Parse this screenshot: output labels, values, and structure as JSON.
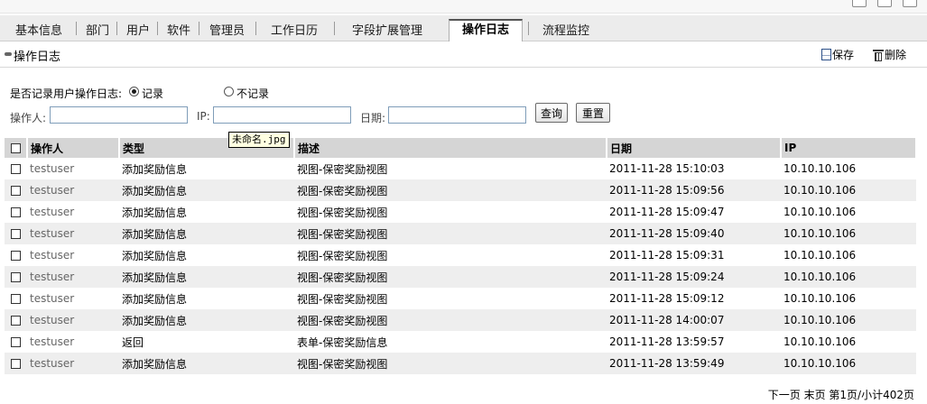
{
  "tabs": [
    {
      "label": "基本信息"
    },
    {
      "label": "部门"
    },
    {
      "label": "用户"
    },
    {
      "label": "软件"
    },
    {
      "label": "管理员"
    },
    {
      "label": "工作日历"
    },
    {
      "label": "字段扩展管理"
    },
    {
      "label": "操作日志"
    },
    {
      "label": "流程监控"
    }
  ],
  "page": {
    "title": "操作日志",
    "save_label": "保存",
    "delete_label": "删除"
  },
  "filters": {
    "record_question": "是否记录用户操作日志:",
    "record_on_label": "记录",
    "record_off_label": "不记录",
    "record_selected": "记录",
    "operator_label": "操作人:",
    "operator_value": "",
    "ip_label": "IP:",
    "ip_value": "",
    "date_label": "日期:",
    "date_value": "",
    "query_label": "查询",
    "reset_label": "重置"
  },
  "tooltip": "未命名.jpg",
  "table": {
    "headers": [
      "操作人",
      "类型",
      "描述",
      "日期",
      "IP"
    ],
    "rows": [
      {
        "user": "testuser",
        "type": "添加奖励信息",
        "desc": "视图-保密奖励视图",
        "date": "2011-11-28 15:10:03",
        "ip": "10.10.10.106"
      },
      {
        "user": "testuser",
        "type": "添加奖励信息",
        "desc": "视图-保密奖励视图",
        "date": "2011-11-28 15:09:56",
        "ip": "10.10.10.106"
      },
      {
        "user": "testuser",
        "type": "添加奖励信息",
        "desc": "视图-保密奖励视图",
        "date": "2011-11-28 15:09:47",
        "ip": "10.10.10.106"
      },
      {
        "user": "testuser",
        "type": "添加奖励信息",
        "desc": "视图-保密奖励视图",
        "date": "2011-11-28 15:09:40",
        "ip": "10.10.10.106"
      },
      {
        "user": "testuser",
        "type": "添加奖励信息",
        "desc": "视图-保密奖励视图",
        "date": "2011-11-28 15:09:31",
        "ip": "10.10.10.106"
      },
      {
        "user": "testuser",
        "type": "添加奖励信息",
        "desc": "视图-保密奖励视图",
        "date": "2011-11-28 15:09:24",
        "ip": "10.10.10.106"
      },
      {
        "user": "testuser",
        "type": "添加奖励信息",
        "desc": "视图-保密奖励视图",
        "date": "2011-11-28 15:09:12",
        "ip": "10.10.10.106"
      },
      {
        "user": "testuser",
        "type": "添加奖励信息",
        "desc": "视图-保密奖励视图",
        "date": "2011-11-28 14:00:07",
        "ip": "10.10.10.106"
      },
      {
        "user": "testuser",
        "type": "返回",
        "desc": "表单-保密奖励信息",
        "date": "2011-11-28 13:59:57",
        "ip": "10.10.10.106"
      },
      {
        "user": "testuser",
        "type": "添加奖励信息",
        "desc": "视图-保密奖励视图",
        "date": "2011-11-28 13:59:49",
        "ip": "10.10.10.106"
      }
    ]
  },
  "pager": {
    "next": "下一页",
    "last": "末页",
    "page": "第1页/小计402页"
  }
}
